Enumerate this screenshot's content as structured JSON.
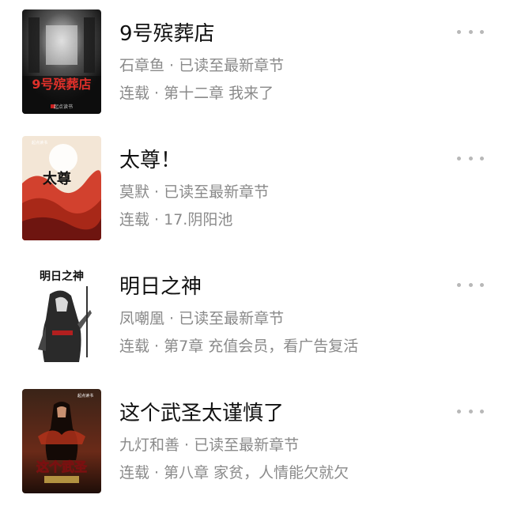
{
  "books": [
    {
      "title": "9号殡葬店",
      "author_status": "石章鱼 · 已读至最新章节",
      "chapter": "连载 · 第十二章 我来了",
      "cover": {
        "text": "9号殡葬店",
        "publisher": "起点读书",
        "theme": "dark"
      }
    },
    {
      "title": "太尊！",
      "author_status": "莫默 · 已读至最新章节",
      "chapter": "连载 · 17.阴阳池",
      "cover": {
        "text": "太尊",
        "publisher": "起点读书",
        "theme": "red-cloud"
      }
    },
    {
      "title": "明日之神",
      "author_status": "凤嘲凰 · 已读至最新章节",
      "chapter": "连载 · 第7章 充值会员，看广告复活",
      "cover": {
        "text": "明日之神",
        "theme": "ink"
      }
    },
    {
      "title": "这个武圣太谨慎了",
      "author_status": "九灯和善 · 已读至最新章节",
      "chapter": "连载 · 第八章 家贫，人情能欠就欠",
      "cover": {
        "text": "这个武圣",
        "publisher": "起点读书",
        "theme": "warrior"
      }
    }
  ],
  "icons": {
    "more": "more-horizontal-icon"
  },
  "colors": {
    "title": "#111111",
    "meta": "#8a8a8a",
    "dots": "#b8b8b8"
  }
}
